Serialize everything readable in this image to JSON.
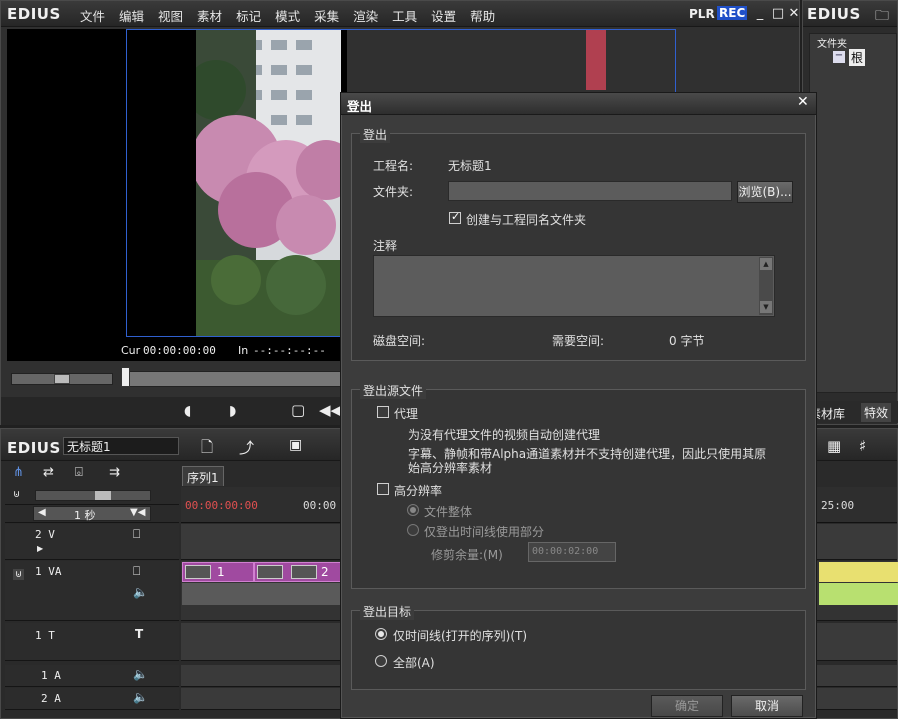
{
  "main_window": {
    "logo": "EDIUS",
    "menu": [
      "文件",
      "编辑",
      "视图",
      "素材",
      "标记",
      "模式",
      "采集",
      "渲染",
      "工具",
      "设置",
      "帮助"
    ],
    "mode_plr": "PLR",
    "mode_rec": "REC",
    "cur_label": "Cur",
    "cur_time": "00:00:00:00",
    "in_label": "In",
    "in_time": "--:--:--:--"
  },
  "bin_window": {
    "logo": "EDIUS",
    "folder_header": "文件夹",
    "root_label": "根",
    "tabs": [
      "素材库",
      "特效"
    ]
  },
  "timeline": {
    "logo": "EDIUS",
    "project_name": "无标题1",
    "sequence_tab": "序列1",
    "scale_label": "1 秒",
    "ruler_start": "00:00:00:00",
    "ruler_mid": "00:00",
    "ruler_end": "25:00",
    "tracks": [
      {
        "name": "2 V"
      },
      {
        "name": "1 VA"
      },
      {
        "name": "1 T"
      },
      {
        "name": "1 A"
      },
      {
        "name": "2 A"
      }
    ],
    "clips": [
      {
        "label": "1"
      },
      {
        "label": "2"
      }
    ]
  },
  "dialog": {
    "title": "登出",
    "section_export": "登出",
    "project_name_label": "工程名:",
    "project_name_value": "无标题1",
    "folder_label": "文件夹:",
    "folder_value": "",
    "browse_button": "浏览(B)...",
    "create_folder_label": "创建与工程同名文件夹",
    "create_folder_checked": true,
    "notes_label": "注释",
    "notes_value": "",
    "disk_space_label": "磁盘空间:",
    "required_space_label": "需要空间:",
    "required_space_value": "0 字节",
    "section_source": "登出源文件",
    "proxy_label": "代理",
    "proxy_checked": false,
    "proxy_desc_1": "为没有代理文件的视频自动创建代理",
    "proxy_desc_2": "字幕、静帧和带Alpha通道素材并不支持创建代理，因此只使用其原",
    "proxy_desc_3": "始高分辨率素材",
    "hires_label": "高分辨率",
    "hires_checked": false,
    "whole_file_label": "文件整体",
    "timeline_part_label": "仅登出时间线使用部分",
    "margin_label": "修剪余量:(M)",
    "margin_value": "00:00:02:00",
    "section_target": "登出目标",
    "timeline_only_label": "仅时间线(打开的序列)(T)",
    "all_label": "全部(A)",
    "target_selected": "timeline_only",
    "ok_button": "确定",
    "cancel_button": "取消"
  },
  "colors": {
    "rec_blue": "#2050c8",
    "clip_purple": "#a04aa0",
    "ruler_red": "#e05050",
    "yellow_track": "#e8e070",
    "green_track": "#b8e070"
  }
}
